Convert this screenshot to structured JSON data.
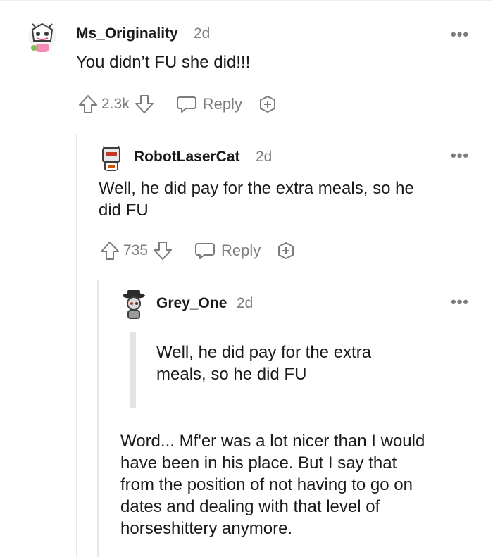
{
  "comments": [
    {
      "username": "Ms_Originality",
      "age": "2d",
      "text": "You didn’t FU she did!!!",
      "votes": "2.3k",
      "reply_label": "Reply",
      "more": "•••"
    },
    {
      "username": "RobotLaserCat",
      "age": "2d",
      "text_lines": [
        "Well, he did pay for the extra meals, so he",
        "did FU"
      ],
      "votes": "735",
      "reply_label": "Reply",
      "more": "•••"
    },
    {
      "username": "Grey_One",
      "age": "2d",
      "quote_lines": [
        "Well, he did pay for the extra",
        "meals, so he did FU"
      ],
      "text_lines": [
        "Word... Mf'er was a lot nicer than I would",
        "have been in his place. But I say that",
        "from the position of not having to go on",
        "dates and dealing with that level of",
        "horseshittery anymore."
      ],
      "more": "•••"
    }
  ],
  "colors": {
    "text": "#1a1a1b",
    "meta": "#7c7c7c",
    "thread_line": "#e5e7e9",
    "quote_bar": "#e2e4e6"
  }
}
